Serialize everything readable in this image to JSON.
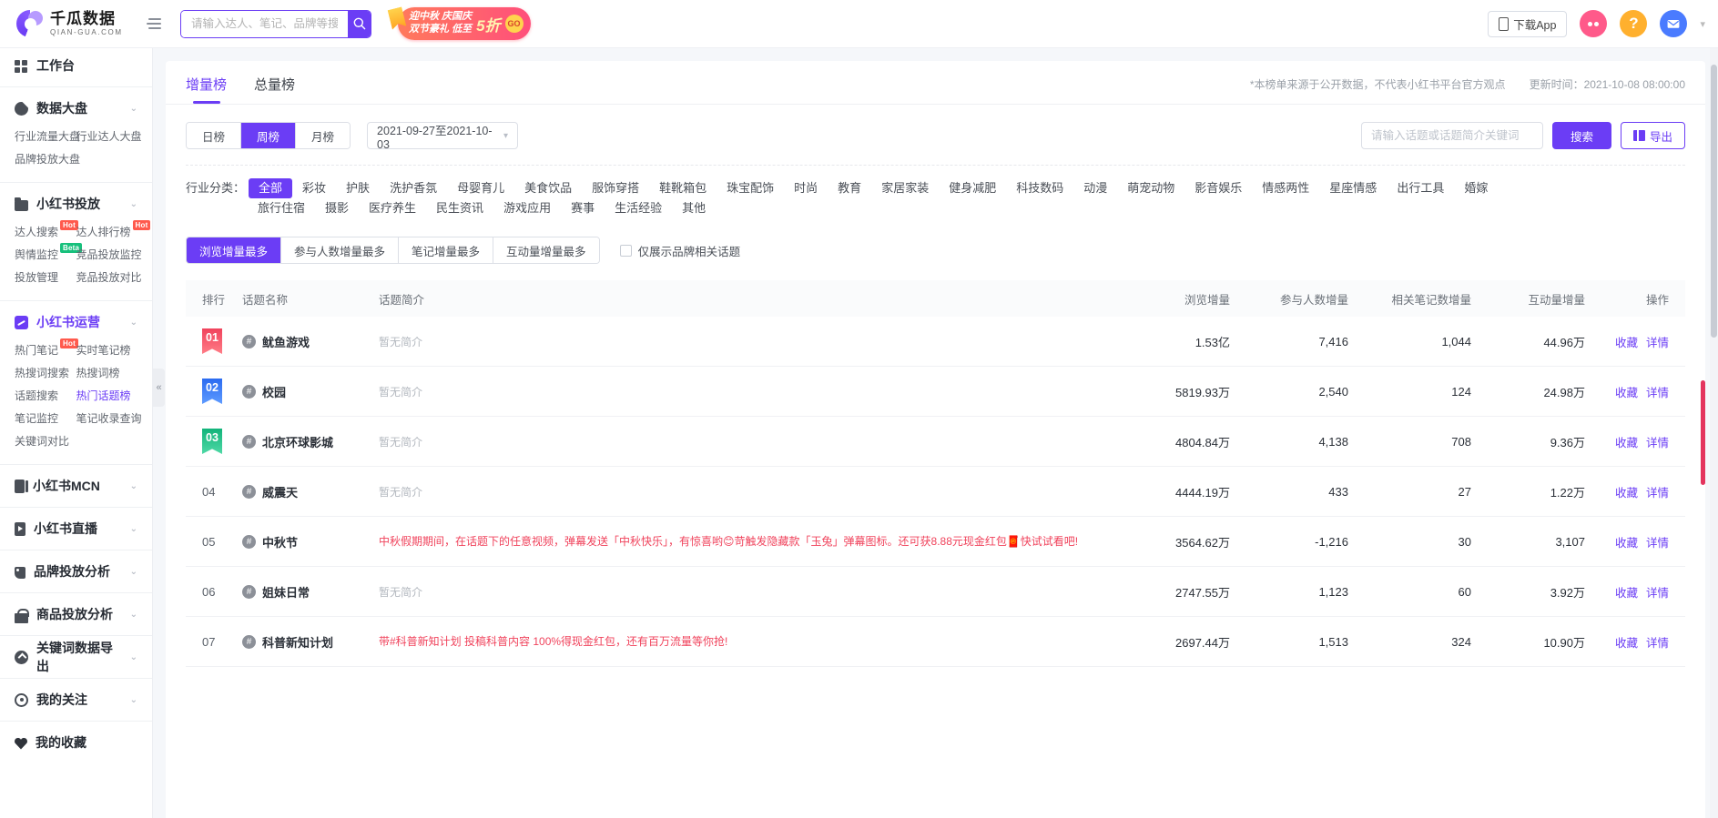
{
  "topbar": {
    "logo_cn": "千瓜数据",
    "logo_en": "QIAN-GUA.COM",
    "collapse_icon": "collapse-menu-icon",
    "search_placeholder": "请输入达人、笔记、品牌等搜",
    "search_value": "",
    "promo_line1": "迎中秋 庆国庆",
    "promo_line2": "双节豪礼 低至",
    "promo_big": "5折",
    "promo_go": "GO",
    "download_app": "下载App",
    "icons": [
      "phone-download-icon",
      "dots-icon",
      "help-icon",
      "mail-icon",
      "chevron-down-icon"
    ]
  },
  "sidebar": {
    "groups": [
      {
        "title": "工作台",
        "icon": "grid-icon",
        "collapsible": false,
        "active": false,
        "links": []
      },
      {
        "title": "数据大盘",
        "icon": "pie-chart-icon",
        "collapsible": true,
        "active": false,
        "links": [
          {
            "label": "行业流量大盘"
          },
          {
            "label": "行业达人大盘"
          },
          {
            "label": "品牌投放大盘"
          }
        ]
      },
      {
        "title": "小红书投放",
        "icon": "folder-icon",
        "collapsible": true,
        "active": false,
        "links": [
          {
            "label": "达人搜索",
            "tag": "Hot",
            "tag_type": "hot"
          },
          {
            "label": "达人排行榜",
            "tag": "Hot",
            "tag_type": "hot"
          },
          {
            "label": "舆情监控",
            "tag": "Beta",
            "tag_type": "beta"
          },
          {
            "label": "竞品投放监控"
          },
          {
            "label": "投放管理"
          },
          {
            "label": "竞品投放对比"
          }
        ]
      },
      {
        "title": "小红书运营",
        "icon": "trend-chart-icon",
        "collapsible": true,
        "active": true,
        "links": [
          {
            "label": "热门笔记",
            "tag": "Hot",
            "tag_type": "hot"
          },
          {
            "label": "实时笔记榜"
          },
          {
            "label": "热搜词搜索"
          },
          {
            "label": "热搜词榜"
          },
          {
            "label": "话题搜索"
          },
          {
            "label": "热门话题榜",
            "selected": true
          },
          {
            "label": "笔记监控"
          },
          {
            "label": "笔记收录查询"
          },
          {
            "label": "关键词对比"
          }
        ]
      },
      {
        "title": "小红书MCN",
        "icon": "mcn-icon",
        "collapsible": true,
        "active": false,
        "links": []
      },
      {
        "title": "小红书直播",
        "icon": "live-video-icon",
        "collapsible": true,
        "active": false,
        "links": []
      },
      {
        "title": "品牌投放分析",
        "icon": "brand-tag-icon",
        "collapsible": true,
        "active": false,
        "links": []
      },
      {
        "title": "商品投放分析",
        "icon": "shopping-bag-icon",
        "collapsible": true,
        "active": false,
        "links": []
      },
      {
        "title": "关键词数据导出",
        "icon": "upload-circle-icon",
        "collapsible": true,
        "active": false,
        "links": []
      },
      {
        "title": "我的关注",
        "icon": "eye-icon",
        "collapsible": true,
        "active": false,
        "links": []
      },
      {
        "title": "我的收藏",
        "icon": "heart-icon",
        "collapsible": false,
        "active": false,
        "links": []
      }
    ],
    "collapse_handle": "«"
  },
  "content": {
    "tabs": [
      {
        "label": "增量榜",
        "active": true
      },
      {
        "label": "总量榜",
        "active": false
      }
    ],
    "disclaimer": "*本榜单来源于公开数据，不代表小红书平台官方观点",
    "update_time": "更新时间：2021-10-08 08:00:00",
    "period_tabs": [
      {
        "label": "日榜",
        "active": false
      },
      {
        "label": "周榜",
        "active": true
      },
      {
        "label": "月榜",
        "active": false
      }
    ],
    "date_range": "2021-09-27至2021-10-03",
    "keyword_placeholder": "请输入话题或话题简介关键词",
    "keyword_value": "",
    "search_button": "搜索",
    "export_button": "导出",
    "category_label": "行业分类：",
    "categories": [
      {
        "label": "全部",
        "active": true
      },
      {
        "label": "彩妆"
      },
      {
        "label": "护肤"
      },
      {
        "label": "洗护香氛"
      },
      {
        "label": "母婴育儿"
      },
      {
        "label": "美食饮品"
      },
      {
        "label": "服饰穿搭"
      },
      {
        "label": "鞋靴箱包"
      },
      {
        "label": "珠宝配饰"
      },
      {
        "label": "时尚"
      },
      {
        "label": "教育"
      },
      {
        "label": "家居家装"
      },
      {
        "label": "健身减肥"
      },
      {
        "label": "科技数码"
      },
      {
        "label": "动漫"
      },
      {
        "label": "萌宠动物"
      },
      {
        "label": "影音娱乐"
      },
      {
        "label": "情感两性"
      },
      {
        "label": "星座情感"
      },
      {
        "label": "出行工具"
      },
      {
        "label": "婚嫁"
      },
      {
        "label": "旅行住宿"
      },
      {
        "label": "摄影"
      },
      {
        "label": "医疗养生"
      },
      {
        "label": "民生资讯"
      },
      {
        "label": "游戏应用"
      },
      {
        "label": "赛事"
      },
      {
        "label": "生活经验"
      },
      {
        "label": "其他"
      }
    ],
    "sort_tabs": [
      {
        "label": "浏览增量最多",
        "active": true
      },
      {
        "label": "参与人数增量最多"
      },
      {
        "label": "笔记增量最多"
      },
      {
        "label": "互动量增量最多"
      }
    ],
    "brand_only_checkbox": {
      "label": "仅展示品牌相关话题",
      "checked": false
    },
    "table": {
      "headers": [
        "排行",
        "话题名称",
        "话题简介",
        "浏览增量",
        "参与人数增量",
        "相关笔记数增量",
        "互动量增量",
        "操作"
      ],
      "op_labels": [
        "收藏",
        "详情"
      ],
      "rows": [
        {
          "rank": "01",
          "medal": "gold",
          "topic": "鱿鱼游戏",
          "desc": "暂无简介",
          "desc_empty": true,
          "views": "1.53亿",
          "people": "7,416",
          "notes": "1,044",
          "interactions": "44.96万"
        },
        {
          "rank": "02",
          "medal": "silver",
          "topic": "校园",
          "desc": "暂无简介",
          "desc_empty": true,
          "views": "5819.93万",
          "people": "2,540",
          "notes": "124",
          "interactions": "24.98万"
        },
        {
          "rank": "03",
          "medal": "bronze",
          "topic": "北京环球影城",
          "desc": "暂无简介",
          "desc_empty": true,
          "views": "4804.84万",
          "people": "4,138",
          "notes": "708",
          "interactions": "9.36万"
        },
        {
          "rank": "04",
          "medal": "none",
          "topic": "威震天",
          "desc": "暂无简介",
          "desc_empty": true,
          "views": "4444.19万",
          "people": "433",
          "notes": "27",
          "interactions": "1.22万"
        },
        {
          "rank": "05",
          "medal": "none",
          "topic": "中秋节",
          "desc": "中秋假期期间，在话题下的任意视频，弹幕发送「中秋快乐」，有惊喜哟😊苛触发隐藏款「玉兔」弹幕图标。还可获8.88元现金红包🧧快试试看吧!",
          "desc_empty": false,
          "views": "3564.62万",
          "people": "-1,216",
          "notes": "30",
          "interactions": "3,107"
        },
        {
          "rank": "06",
          "medal": "none",
          "topic": "姐妹日常",
          "desc": "暂无简介",
          "desc_empty": true,
          "views": "2747.55万",
          "people": "1,123",
          "notes": "60",
          "interactions": "3.92万"
        },
        {
          "rank": "07",
          "medal": "none",
          "topic": "科普新知计划",
          "desc": "带#科普新知计划 投稿科普内容 100%得现金红包，还有百万流量等你抢!",
          "desc_empty": false,
          "views": "2697.44万",
          "people": "1,513",
          "notes": "324",
          "interactions": "10.90万"
        }
      ]
    }
  }
}
